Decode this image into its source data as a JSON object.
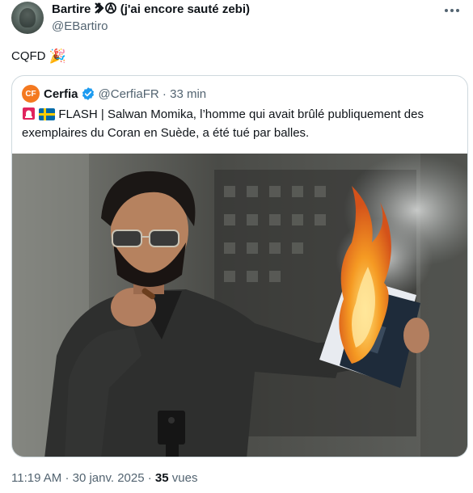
{
  "tweet": {
    "display_name": "Bartire",
    "name_suffix": "(j'ai encore sauté zebi)",
    "handle": "@EBartiro",
    "text": "CQFD",
    "text_emoji": "🎉",
    "time": "11:19 AM",
    "date": "30 janv. 2025",
    "views_count": "35",
    "views_label": "vues"
  },
  "quote": {
    "logo_text": "CF",
    "name": "Cerfia",
    "handle": "@CerfiaFR",
    "time_ago": "33 min",
    "flash_label": "FLASH",
    "text": "Salwan Momika, l’homme qui avait brûlé publiquement des exemplaires du Coran en Suède, a été tué par balles."
  },
  "icons": {
    "more": "more-icon",
    "verified": "verified-badge-icon",
    "siren": "siren-icon",
    "flag": "sweden-flag-icon",
    "party": "party-popper-icon"
  },
  "colors": {
    "text": "#0f1419",
    "secondary": "#536471",
    "border": "#cfd9de",
    "verified": "#1d9bf0",
    "cerfia_orange": "#f47920"
  }
}
